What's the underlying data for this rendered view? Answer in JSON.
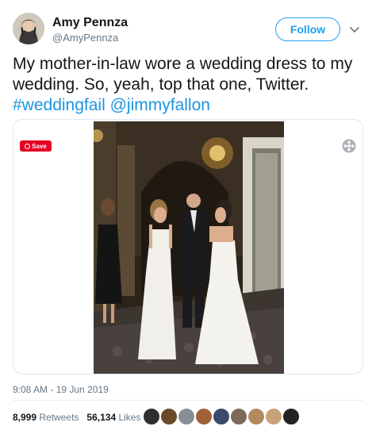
{
  "author": {
    "name": "Amy Pennza",
    "handle": "@AmyPennza",
    "avatar_icon": "user-avatar"
  },
  "follow_label": "Follow",
  "tweet": {
    "text": "My mother-in-law wore a wedding dress to my wedding. So, yeah, top that one, Twitter.",
    "hashtag": "#weddingfail",
    "mention": "@jimmyfallon"
  },
  "media": {
    "save_label": "Save",
    "expand_icon": "expand-icon"
  },
  "timestamp": "9:08 AM - 19 Jun 2019",
  "stats": {
    "retweets_count": "8,999",
    "retweets_label": "Retweets",
    "likes_count": "56,134",
    "likes_label": "Likes"
  },
  "colors": {
    "accent": "#1da1f2",
    "link": "#1b95e0",
    "pinterest": "#e60023"
  }
}
